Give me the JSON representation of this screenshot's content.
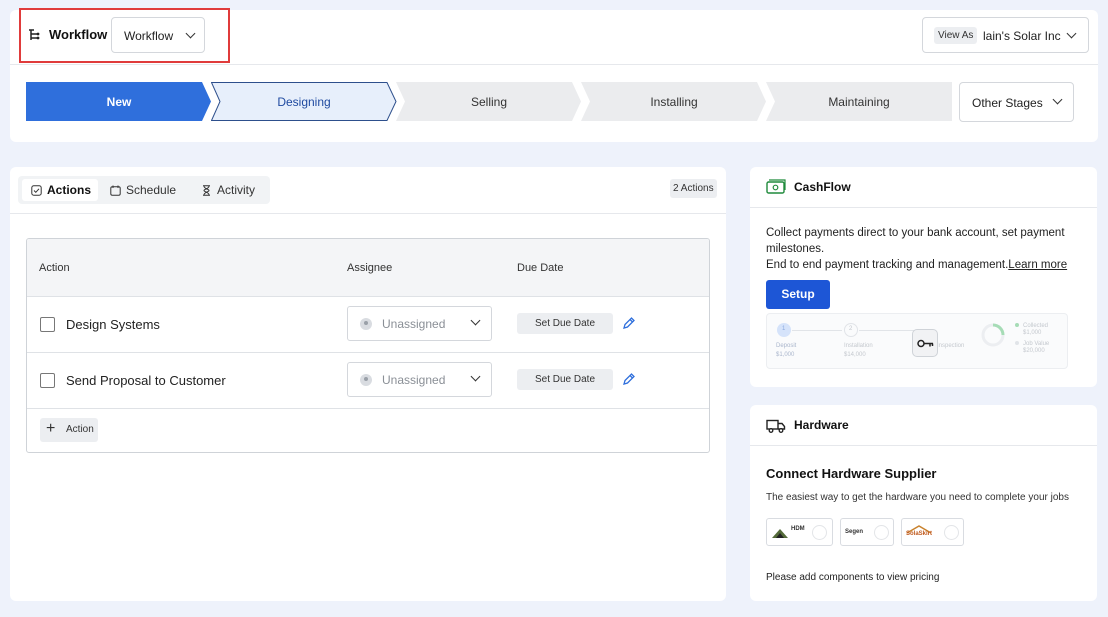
{
  "header": {
    "title": "Workflow",
    "workflow_select": "Workflow",
    "view_as_label": "View As",
    "view_as_value": "lain's Solar Inc"
  },
  "stages": [
    {
      "label": "New",
      "state": "active"
    },
    {
      "label": "Designing",
      "state": "current"
    },
    {
      "label": "Selling",
      "state": "pending"
    },
    {
      "label": "Installing",
      "state": "pending"
    },
    {
      "label": "Maintaining",
      "state": "pending"
    }
  ],
  "other_stages": "Other Stages",
  "tabs": [
    {
      "label": "Actions",
      "icon": "checkbox-icon",
      "active": true
    },
    {
      "label": "Schedule",
      "icon": "calendar-icon",
      "active": false
    },
    {
      "label": "Activity",
      "icon": "hourglass-icon",
      "active": false
    }
  ],
  "actions_count": "2 Actions",
  "table": {
    "headers": [
      "Action",
      "Assignee",
      "Due Date"
    ],
    "rows": [
      {
        "name": "Design Systems",
        "assignee": "Unassigned",
        "due": "Set Due Date"
      },
      {
        "name": "Send Proposal to Customer",
        "assignee": "Unassigned",
        "due": "Set Due Date"
      }
    ],
    "add_label": "Action"
  },
  "cashflow": {
    "title": "CashFlow",
    "text": "Collect payments direct to your bank account, set payment milestones.",
    "text2": "End to end payment tracking and management.",
    "link": "Learn more",
    "setup": "Setup",
    "preview": {
      "step1": "1",
      "step1_label": "Deposit",
      "step1_amount": "$1,000",
      "step2": "2",
      "step2_label": "Installation",
      "step2_amount": "$14,000",
      "step3_label": "Inspection",
      "legend1": "Collected",
      "legend1_amount": "$1,000",
      "legend2": "Job Value",
      "legend2_amount": "$20,000"
    }
  },
  "hardware": {
    "title": "Hardware",
    "heading": "Connect Hardware Supplier",
    "subtitle": "The easiest way to get the hardware you need to complete your jobs",
    "suppliers": [
      "HDM",
      "Segen",
      "SolaSkirt"
    ],
    "note": "Please add components to view pricing"
  },
  "colors": {
    "primary": "#1d56d6",
    "active_stage": "#2f6fdc",
    "current_stage_bg": "#e7effb",
    "pending_stage": "#ebecee",
    "highlight": "#e03b3b",
    "cash_icon": "#1f8a3b"
  }
}
